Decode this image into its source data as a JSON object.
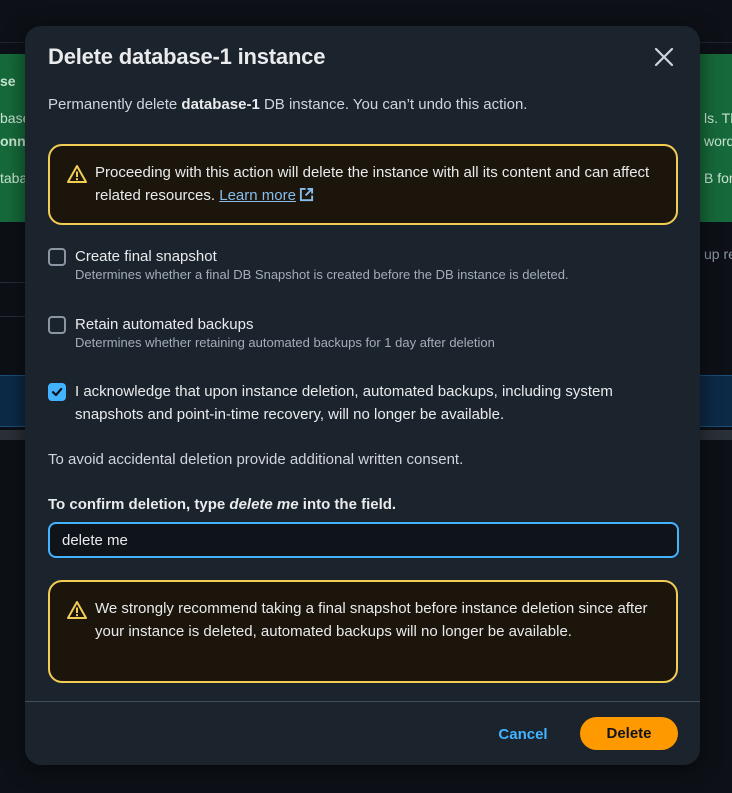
{
  "background": {
    "left_fragments": [
      "se ",
      "base",
      "onn",
      "taba"
    ],
    "right_fragments": [
      "ls. Th",
      "word",
      "B for"
    ],
    "side_text": "up re"
  },
  "modal": {
    "title": "Delete database-1 instance",
    "intro_prefix": "Permanently delete ",
    "intro_bold": "database-1",
    "intro_suffix": " DB instance. You can’t undo this action.",
    "warning_top": {
      "text": "Proceeding with this action will delete the instance with all its content and can affect related resources. ",
      "link_label": "Learn more"
    },
    "options": [
      {
        "label": "Create final snapshot",
        "description": "Determines whether a final DB Snapshot is created before the DB instance is deleted.",
        "checked": false
      },
      {
        "label": "Retain automated backups",
        "description": "Determines whether retaining automated backups for 1 day after deletion",
        "checked": false
      },
      {
        "label": "I acknowledge that upon instance deletion, automated backups, including system snapshots and point-in-time recovery, will no longer be available.",
        "checked": true
      }
    ],
    "consent_note": "To avoid accidental deletion provide additional written consent.",
    "confirm": {
      "label_prefix": "To confirm deletion, type ",
      "label_phrase": "delete me",
      "label_suffix": " into the field.",
      "value": "delete me"
    },
    "warning_bottom": {
      "text": "We strongly recommend taking a final snapshot before instance deletion since after your instance is deleted, automated backups will no longer be available."
    },
    "buttons": {
      "cancel": "Cancel",
      "delete": "Delete"
    }
  },
  "colors": {
    "modal_bg": "#1b232d",
    "warning_border": "#f2cd54",
    "accent_blue": "#42b4ff",
    "primary_orange": "#ff9900",
    "success_green": "#16693a"
  }
}
